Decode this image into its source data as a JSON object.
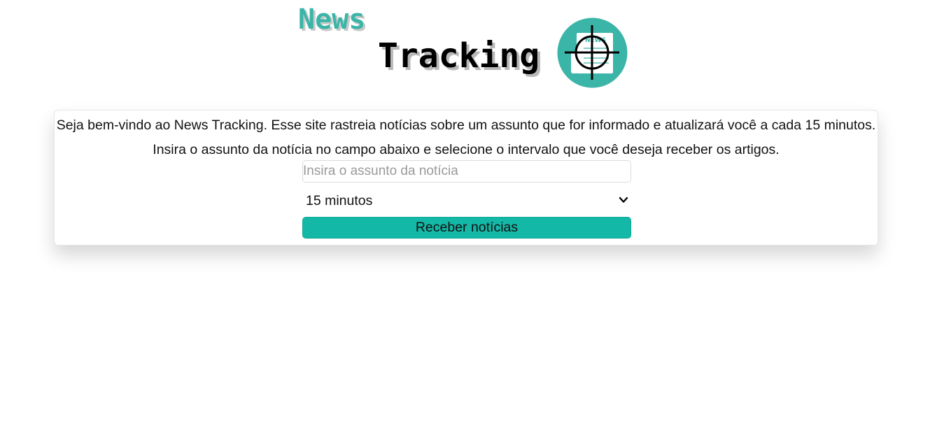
{
  "header": {
    "title_top": "News",
    "title_bottom": "Tracking",
    "logo_label": "NEWS"
  },
  "colors": {
    "accent": "#13b8a6",
    "title_accent": "#3ab5a7",
    "logo_circle": "#3ab5a7"
  },
  "card": {
    "welcome_text": "Seja bem-vindo ao News Tracking. Esse site rastreia notícias sobre um assunto que for informado e atualizará você a cada 15 minutos.",
    "instruction_text": "Insira o assunto da notícia no campo abaixo e selecione o intervalo que você deseja receber os artigos."
  },
  "form": {
    "subject_placeholder": "Insira o assunto da notícia",
    "subject_value": "",
    "interval_selected": "15 minutos",
    "submit_label": "Receber notícias"
  },
  "icons": {
    "logo": "crosshair-newspaper-icon",
    "select": "chevron-down-icon"
  }
}
